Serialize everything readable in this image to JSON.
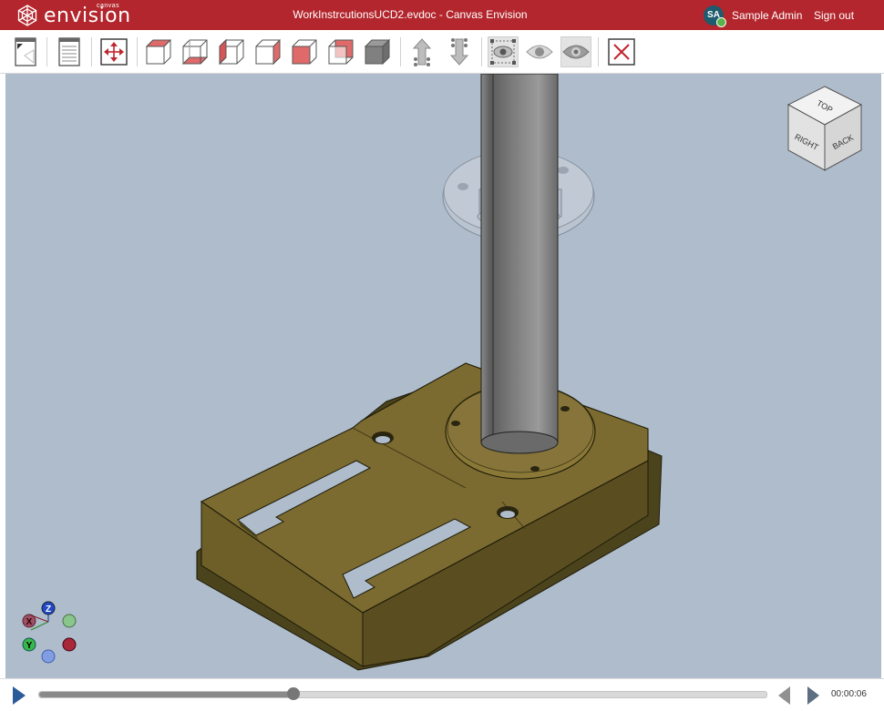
{
  "app": {
    "brand": "envision",
    "brand_sub": "canvas",
    "document_title": "WorkInstrcutionsUCD2.evdoc - Canvas Envision",
    "user_initials": "SA",
    "user_name": "Sample Admin",
    "sign_out_label": "Sign out"
  },
  "toolbar": {
    "buttons": [
      {
        "name": "page-properties-button",
        "icon": "page-corner-icon"
      },
      {
        "name": "document-button",
        "icon": "document-lines-icon"
      },
      {
        "name": "fit-all-button",
        "icon": "expand-arrows-icon"
      },
      {
        "name": "view-front-button",
        "icon": "cube-front-face-icon"
      },
      {
        "name": "view-bottom-button",
        "icon": "cube-bottom-face-icon"
      },
      {
        "name": "view-left-button",
        "icon": "cube-left-face-icon"
      },
      {
        "name": "view-right-button",
        "icon": "cube-right-face-icon"
      },
      {
        "name": "view-back-button",
        "icon": "cube-back-face-icon"
      },
      {
        "name": "view-top-button",
        "icon": "cube-top-face-icon"
      },
      {
        "name": "view-isometric-button",
        "icon": "solid-cube-icon"
      },
      {
        "name": "explode-up-button",
        "icon": "arrow-up-icon"
      },
      {
        "name": "collapse-button",
        "icon": "arrow-down-icon"
      },
      {
        "name": "select-visibility-button",
        "icon": "eye-select-icon"
      },
      {
        "name": "show-button",
        "icon": "eye-icon"
      },
      {
        "name": "hide-button",
        "icon": "eye-filled-icon"
      },
      {
        "name": "close-button",
        "icon": "close-icon"
      }
    ]
  },
  "viewcube": {
    "top": "TOP",
    "right": "RIGHT",
    "back": "BACK"
  },
  "triad": {
    "z": "Z",
    "y": "Y",
    "x": "X"
  },
  "colors": {
    "brand": "#b3262d",
    "viewport_bg": "#aebccb",
    "base_plate": "#7a6a2f",
    "cylinder": "#6f6f6f"
  },
  "playback": {
    "progress": 0.349,
    "time": "00:00:06"
  }
}
